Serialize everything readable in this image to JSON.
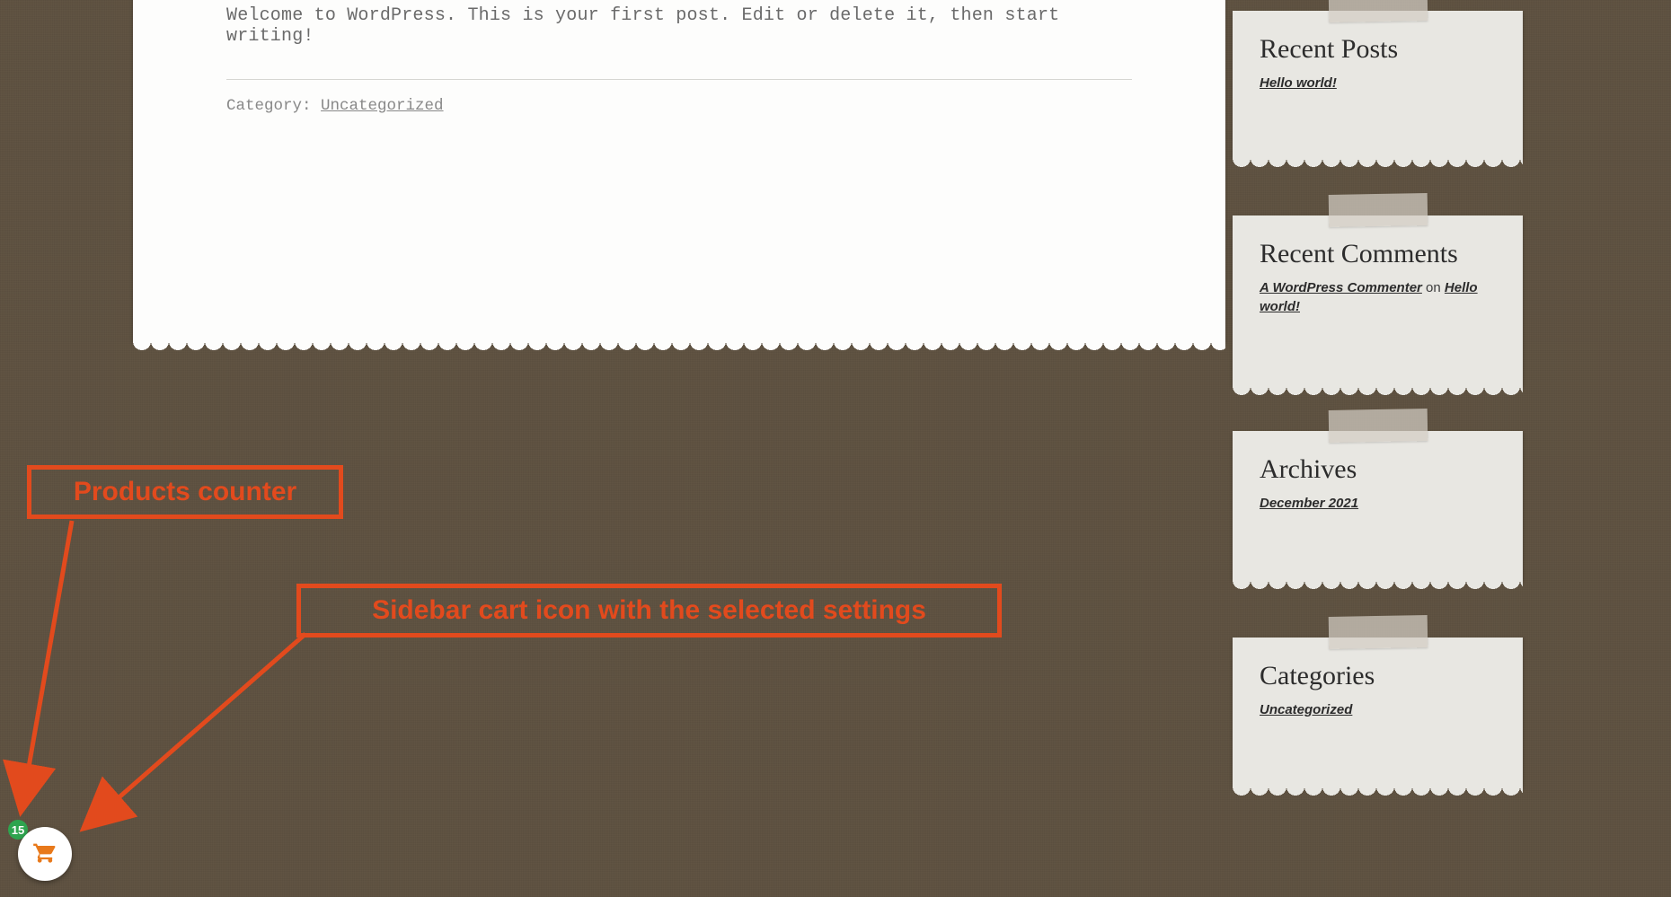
{
  "post": {
    "body": "Welcome to WordPress. This is your first post. Edit or delete it, then start writing!",
    "category_label": "Category: ",
    "category_link": "Uncategorized"
  },
  "widgets": {
    "recent_posts": {
      "title": "Recent Posts",
      "item": "Hello world!"
    },
    "recent_comments": {
      "title": "Recent Comments",
      "author": "A WordPress Commenter",
      "on": " on ",
      "post": "Hello world!"
    },
    "archives": {
      "title": "Archives",
      "item": "December 2021"
    },
    "categories": {
      "title": "Categories",
      "item": "Uncategorized"
    }
  },
  "annotations": {
    "products_counter": "Products counter",
    "cart_icon": "Sidebar cart icon with the selected settings"
  },
  "cart": {
    "count": "15"
  }
}
